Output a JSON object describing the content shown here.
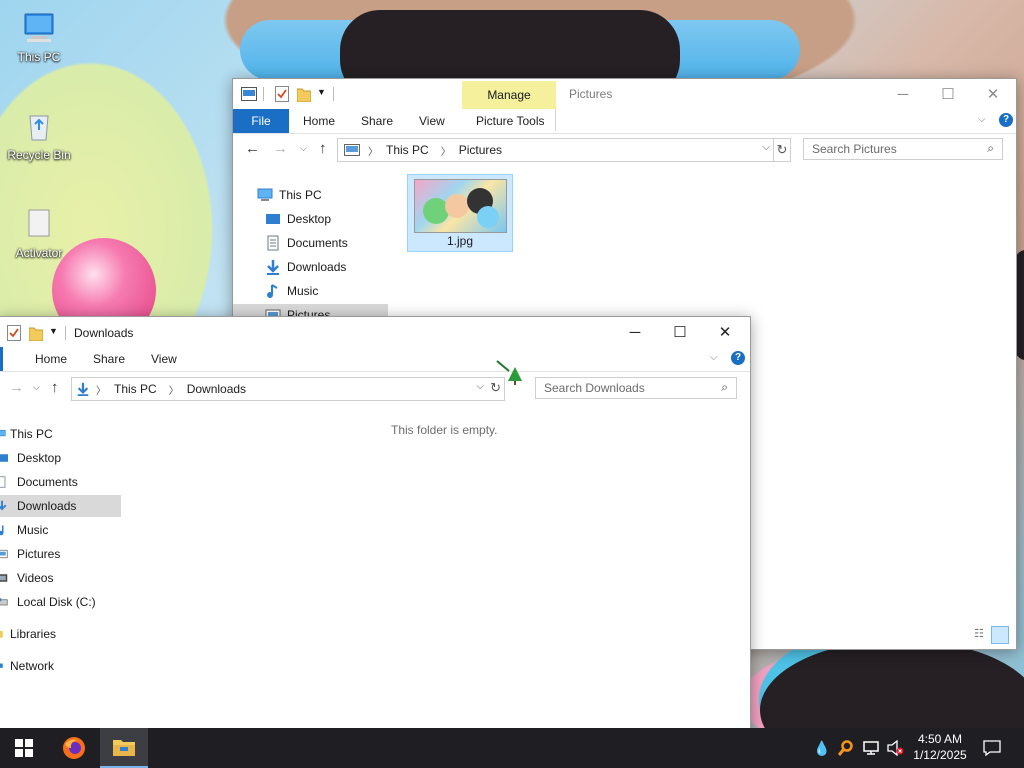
{
  "desktop": {
    "icons": [
      {
        "label": "This PC"
      },
      {
        "label": "Recycle Bin"
      },
      {
        "label": "Activator"
      }
    ]
  },
  "pictures_window": {
    "title_manage_tab": "Manage",
    "title": "Pictures",
    "tabs": {
      "file": "File",
      "home": "Home",
      "share": "Share",
      "view": "View",
      "picture_tools": "Picture Tools"
    },
    "breadcrumb": [
      "This PC",
      "Pictures"
    ],
    "search_placeholder": "Search Pictures",
    "nav": [
      "This PC",
      "Desktop",
      "Documents",
      "Downloads",
      "Music",
      "Pictures"
    ],
    "files": [
      {
        "name": "1.jpg"
      }
    ]
  },
  "downloads_window": {
    "title": "Downloads",
    "tabs": {
      "home": "Home",
      "share": "Share",
      "view": "View"
    },
    "breadcrumb": [
      "This PC",
      "Downloads"
    ],
    "search_placeholder": "Search Downloads",
    "empty_message": "This folder is empty.",
    "nav": [
      "This PC",
      "Desktop",
      "Documents",
      "Downloads",
      "Music",
      "Pictures",
      "Videos",
      "Local Disk (C:)",
      "Libraries",
      "Network"
    ],
    "selected_nav": "Downloads"
  },
  "taskbar": {
    "time": "4:50 AM",
    "date": "1/12/2025"
  },
  "colors": {
    "accent": "#1a6fc4",
    "manage_tab": "#f4f09b",
    "taskbar": "#1f1f23",
    "selection": "#d9d9d9"
  }
}
